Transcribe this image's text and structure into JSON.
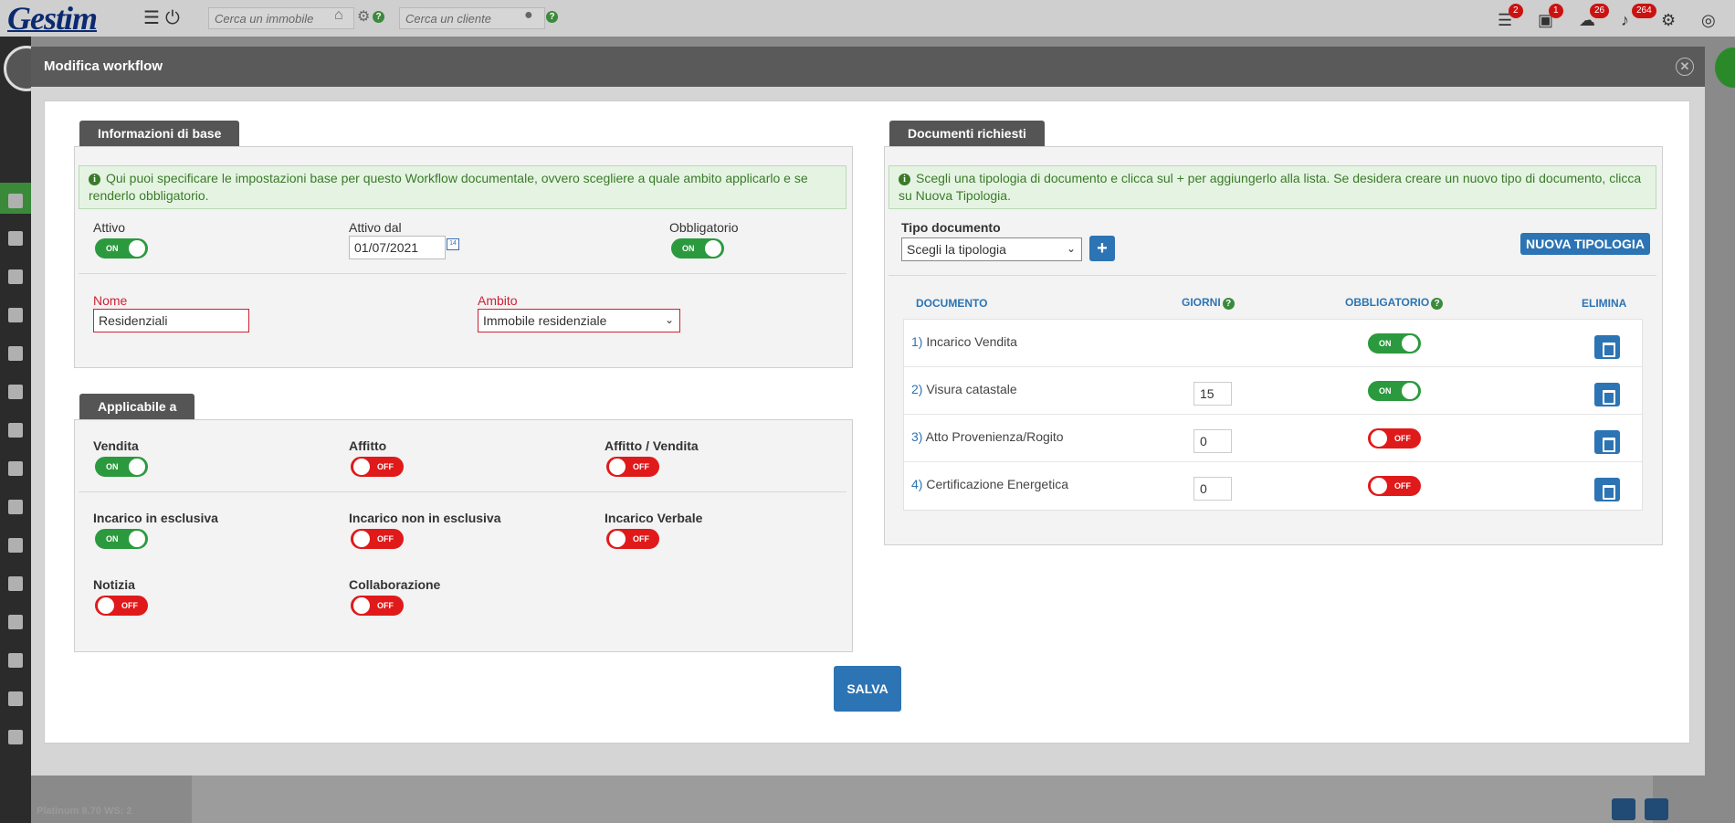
{
  "app": {
    "logo": "Gestim",
    "search_property_placeholder": "Cerca un immobile",
    "search_client_placeholder": "Cerca un cliente",
    "notifications": [
      {
        "name": "tasks",
        "count": "2"
      },
      {
        "name": "calendar-x",
        "count": "1"
      },
      {
        "name": "cloud",
        "count": "26"
      },
      {
        "name": "bell",
        "count": "264"
      }
    ],
    "version": "Platinum 8.70",
    "ws": "WS: 2"
  },
  "modal": {
    "title": "Modifica workflow",
    "save_label": "SALVA"
  },
  "base_info": {
    "legend": "Informazioni di base",
    "info": "Qui puoi specificare le impostazioni base per questo Workflow documentale, ovvero scegliere a quale ambito applicarlo e se renderlo obbligatorio.",
    "attivo_label": "Attivo",
    "attivo_value": "ON",
    "attivo_dal_label": "Attivo dal",
    "attivo_dal_value": "01/07/2021",
    "obbligatorio_label": "Obbligatorio",
    "obbligatorio_value": "ON",
    "nome_label": "Nome",
    "nome_value": "Residenziali",
    "ambito_label": "Ambito",
    "ambito_value": "Immobile residenziale"
  },
  "applicable": {
    "legend": "Applicabile a",
    "items": [
      {
        "label": "Vendita",
        "state": "ON"
      },
      {
        "label": "Affitto",
        "state": "OFF"
      },
      {
        "label": "Affitto / Vendita",
        "state": "OFF"
      },
      {
        "label": "Incarico in esclusiva",
        "state": "ON"
      },
      {
        "label": "Incarico non in esclusiva",
        "state": "OFF"
      },
      {
        "label": "Incarico Verbale",
        "state": "OFF"
      },
      {
        "label": "Notizia",
        "state": "OFF"
      },
      {
        "label": "Collaborazione",
        "state": "OFF"
      }
    ]
  },
  "documents": {
    "legend": "Documenti richiesti",
    "info": "Scegli una tipologia di documento e clicca sul + per aggiungerlo alla lista. Se desidera creare un nuovo tipo di documento, clicca su Nuova Tipologia.",
    "tipo_label": "Tipo documento",
    "tipo_value": "Scegli la tipologia",
    "add_label": "+",
    "new_type_label": "NUOVA TIPOLOGIA",
    "columns": {
      "documento": "DOCUMENTO",
      "giorni": "GIORNI",
      "obbligatorio": "OBBLIGATORIO",
      "elimina": "ELIMINA"
    },
    "rows": [
      {
        "num": "1)",
        "name": "Incarico Vendita",
        "days": "",
        "required": "ON"
      },
      {
        "num": "2)",
        "name": "Visura catastale",
        "days": "15",
        "required": "ON"
      },
      {
        "num": "3)",
        "name": "Atto Provenienza/Rogito",
        "days": "0",
        "required": "OFF"
      },
      {
        "num": "4)",
        "name": "Certificazione Energetica",
        "days": "0",
        "required": "OFF"
      }
    ]
  }
}
